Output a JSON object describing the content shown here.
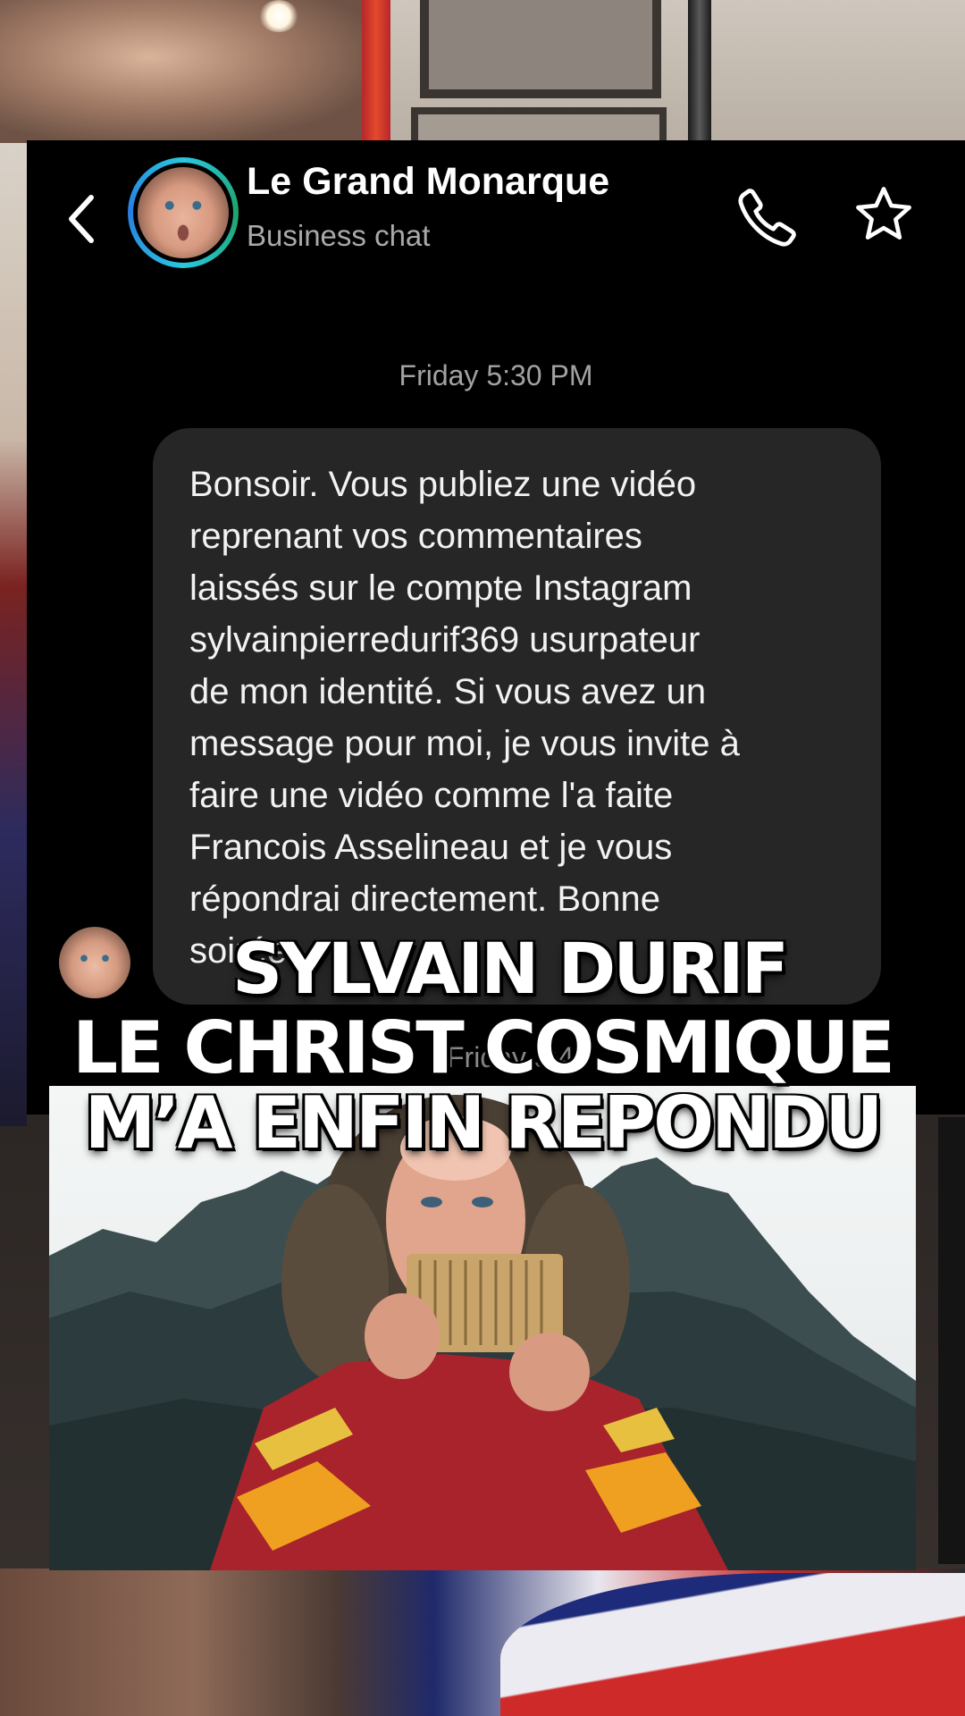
{
  "chat": {
    "contact_name": "Le Grand Monarque",
    "contact_subtitle": "Business chat",
    "timestamp": "Friday 5:30 PM",
    "message": "Bonsoir. Vous publiez une vidéo\nreprenant vos commentaires\nlaissés sur le compte Instagram\nsylvainpierredurif369 usurpateur\nde mon identité. Si vous avez un\nmessage pour moi, je vous invite à\nfaire une vidéo comme l'a faite\nFrancois Asselineau et je vous\nrépondrai directement. Bonne\nsoirée",
    "timestamp_partial": "Friday 5:45"
  },
  "overlay": {
    "line1": "SYLVAIN DURIF",
    "line2": "LE CHRIST COSMIQUE",
    "line3": "M’A ENFIN REPONDU"
  },
  "icons": {
    "back": "chevron-left-icon",
    "call": "phone-icon",
    "favorite": "star-icon"
  },
  "colors": {
    "chat_background": "#000000",
    "bubble": "#262626",
    "avatar_ring": "#29c7e0",
    "title_text": "#ffffff"
  }
}
